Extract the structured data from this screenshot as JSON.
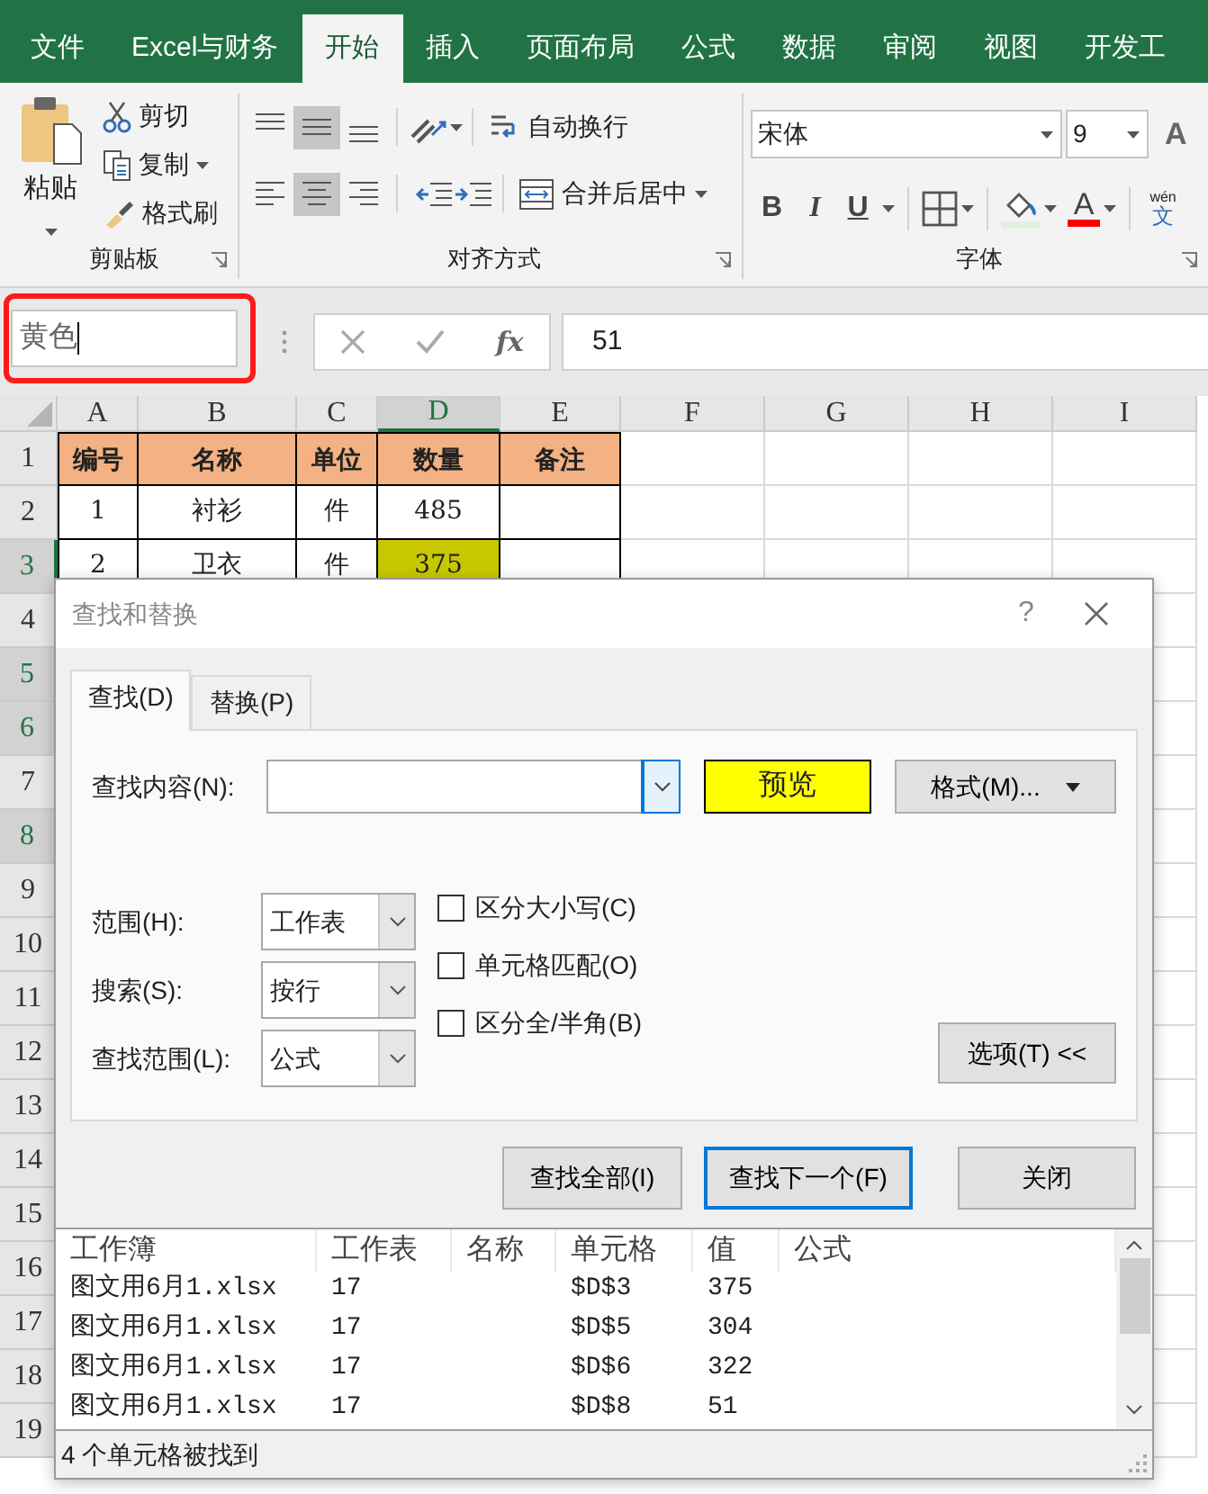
{
  "ribbon_tabs": [
    {
      "label": "文件",
      "selected": false
    },
    {
      "label": "Excel与财务",
      "selected": false
    },
    {
      "label": "开始",
      "selected": true
    },
    {
      "label": "插入",
      "selected": false
    },
    {
      "label": "页面布局",
      "selected": false
    },
    {
      "label": "公式",
      "selected": false
    },
    {
      "label": "数据",
      "selected": false
    },
    {
      "label": "审阅",
      "selected": false
    },
    {
      "label": "视图",
      "selected": false
    },
    {
      "label": "开发工",
      "selected": false
    }
  ],
  "clipboard": {
    "paste": "粘贴",
    "cut": "剪切",
    "copy": "复制",
    "format_painter": "格式刷",
    "title": "剪贴板"
  },
  "alignment": {
    "vertical": [
      {
        "kind": "top",
        "selected": false
      },
      {
        "kind": "middle",
        "selected": true
      },
      {
        "kind": "bottom",
        "selected": false
      }
    ],
    "horizontal": [
      {
        "kind": "left",
        "selected": false
      },
      {
        "kind": "center",
        "selected": true
      },
      {
        "kind": "right",
        "selected": false
      }
    ],
    "wrap_text": "自动换行",
    "merge_center": "合并后居中",
    "title": "对齐方式"
  },
  "font": {
    "name": "宋体",
    "size": "9",
    "grow": "A",
    "bold": "B",
    "italic": "I",
    "underline": "U",
    "font_color": "A",
    "phonetic": {
      "ruby": "wén",
      "base": "文"
    },
    "title": "字体"
  },
  "name_box": {
    "value": "黄色"
  },
  "formula": {
    "fx": "fx",
    "value": "51"
  },
  "columns": [
    {
      "label": "A",
      "selected": false
    },
    {
      "label": "B",
      "selected": false
    },
    {
      "label": "C",
      "selected": false
    },
    {
      "label": "D",
      "selected": true
    },
    {
      "label": "E",
      "selected": false
    },
    {
      "label": "F",
      "selected": false
    },
    {
      "label": "G",
      "selected": false
    },
    {
      "label": "H",
      "selected": false
    },
    {
      "label": "I",
      "selected": false
    }
  ],
  "rows": [
    {
      "label": "1",
      "selected": false,
      "cells": [
        {
          "kind": "header",
          "text": "编号"
        },
        {
          "kind": "header",
          "text": "名称"
        },
        {
          "kind": "header",
          "text": "单位"
        },
        {
          "kind": "header",
          "text": "数量"
        },
        {
          "kind": "header",
          "text": "备注"
        }
      ]
    },
    {
      "label": "2",
      "selected": false,
      "cells": [
        {
          "kind": "data",
          "text": "1"
        },
        {
          "kind": "data",
          "text": "衬衫"
        },
        {
          "kind": "data",
          "text": "件"
        },
        {
          "kind": "data",
          "text": "485"
        },
        {
          "kind": "data"
        }
      ]
    },
    {
      "label": "3",
      "selected": true,
      "cells": [
        {
          "kind": "data",
          "text": "2"
        },
        {
          "kind": "data",
          "text": "卫衣"
        },
        {
          "kind": "data",
          "text": "件"
        },
        {
          "kind": "found",
          "text": "375"
        },
        {
          "kind": "data"
        }
      ]
    },
    {
      "label": "4",
      "selected": false,
      "cells": []
    },
    {
      "label": "5",
      "selected": true,
      "cells": []
    },
    {
      "label": "6",
      "selected": true,
      "cells": []
    },
    {
      "label": "7",
      "selected": false,
      "cells": []
    },
    {
      "label": "8",
      "selected": true,
      "cells": []
    },
    {
      "label": "9",
      "selected": false,
      "cells": []
    },
    {
      "label": "10",
      "selected": false,
      "cells": []
    },
    {
      "label": "11",
      "selected": false,
      "cells": []
    },
    {
      "label": "12",
      "selected": false,
      "cells": []
    },
    {
      "label": "13",
      "selected": false,
      "cells": []
    },
    {
      "label": "14",
      "selected": false,
      "cells": []
    },
    {
      "label": "15",
      "selected": false,
      "cells": []
    },
    {
      "label": "16",
      "selected": false,
      "cells": []
    },
    {
      "label": "17",
      "selected": false,
      "cells": []
    },
    {
      "label": "18",
      "selected": false,
      "cells": []
    },
    {
      "label": "19",
      "selected": false,
      "cells": []
    }
  ],
  "dialog": {
    "title": "查找和替换",
    "help": "?",
    "tabs": [
      {
        "label": "查找(D)",
        "selected": true
      },
      {
        "label": "替换(P)",
        "selected": false
      }
    ],
    "find_label": "查找内容(N):",
    "preview": "预览",
    "format_button": "格式(M)...",
    "options": [
      {
        "label": "范围(H):",
        "value": "工作表"
      },
      {
        "label": "搜索(S):",
        "value": "按行"
      },
      {
        "label": "查找范围(L):",
        "value": "公式"
      }
    ],
    "checkboxes": [
      {
        "label": "区分大小写(C)",
        "checked": false
      },
      {
        "label": "单元格匹配(O)",
        "checked": false
      },
      {
        "label": "区分全/半角(B)",
        "checked": false
      }
    ],
    "options_button": "选项(T) <<",
    "buttons": [
      {
        "label": "查找全部(I)",
        "default": false
      },
      {
        "label": "查找下一个(F)",
        "default": true
      },
      {
        "label": "关闭",
        "default": false
      }
    ],
    "results": {
      "columns": [
        "工作簿",
        "工作表",
        "名称",
        "单元格",
        "值",
        "公式"
      ],
      "rows": [
        {
          "workbook": "图文用6月1.xlsx",
          "sheet": "17",
          "cell": "$D$3",
          "value": "375"
        },
        {
          "workbook": "图文用6月1.xlsx",
          "sheet": "17",
          "cell": "$D$5",
          "value": "304"
        },
        {
          "workbook": "图文用6月1.xlsx",
          "sheet": "17",
          "cell": "$D$6",
          "value": "322"
        },
        {
          "workbook": "图文用6月1.xlsx",
          "sheet": "17",
          "cell": "$D$8",
          "value": "51"
        }
      ]
    },
    "status": "4 个单元格被找到"
  }
}
